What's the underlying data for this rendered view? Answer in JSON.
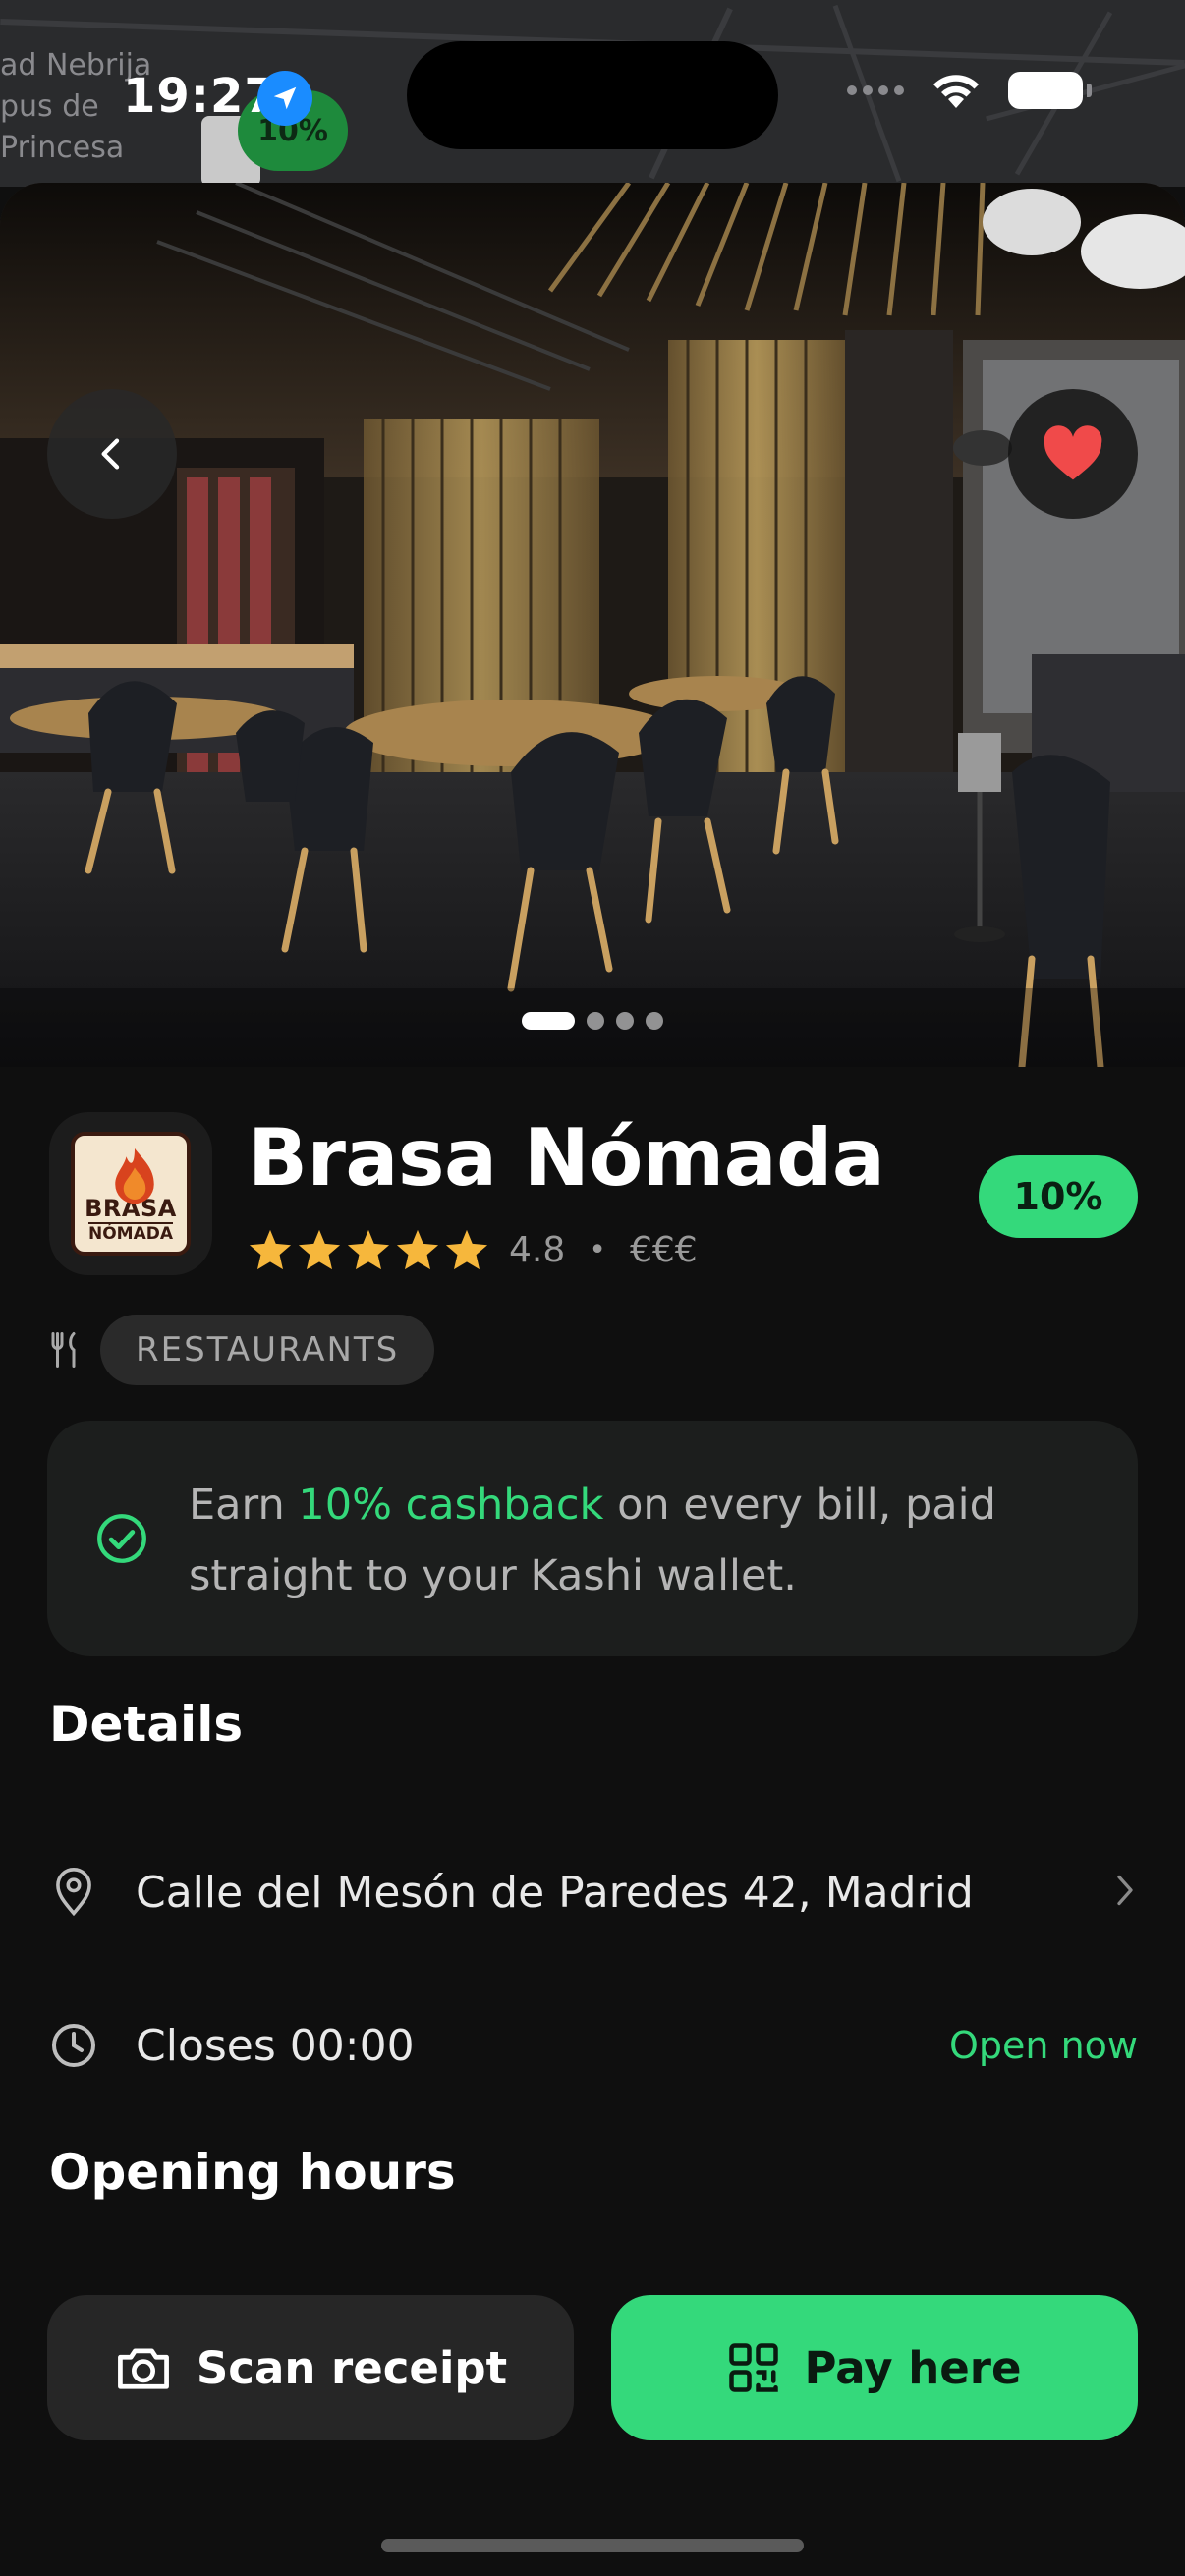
{
  "status_bar": {
    "time": "19:27"
  },
  "map": {
    "labels": [
      "ad Nebrija",
      "pus de",
      "Princesa"
    ],
    "pin_badge": "10%"
  },
  "hero": {
    "slides_total": 4,
    "active_slide": 1
  },
  "restaurant": {
    "name": "Brasa Nómada",
    "logo_line1": "BRASA",
    "logo_line2": "NÓMADA",
    "rating": "4.8",
    "stars": 5,
    "separator": "•",
    "price_level": "€€€",
    "cashback_badge": "10%",
    "category": "RESTAURANTS"
  },
  "cashback_info": {
    "prefix": "Earn ",
    "highlight": "10% cashback",
    "suffix": " on every bill, paid straight to your Kashi wallet."
  },
  "details": {
    "title": "Details",
    "address": "Calle del Mesón de Paredes 42, Madrid",
    "hours_text": "Closes 00:00",
    "open_status": "Open now"
  },
  "opening_hours": {
    "title": "Opening hours"
  },
  "actions": {
    "scan_label": "Scan receipt",
    "pay_label": "Pay here"
  },
  "colors": {
    "accent": "#34d97b",
    "background": "#0f0f0f",
    "star": "#f6b73c",
    "heart": "#f04a4a"
  }
}
